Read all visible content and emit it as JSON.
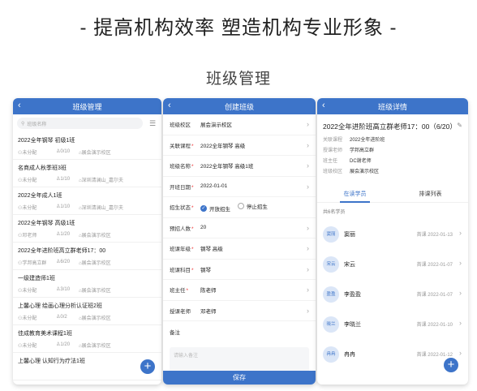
{
  "headline": "- 提高机构效率 塑造机构专业形象 -",
  "subtitle": "班级管理",
  "list_screen": {
    "title": "班级管理",
    "search_placeholder": "班级名称",
    "classes": [
      {
        "name": "2022全年钢琴 初级1班",
        "teacher": "未分配",
        "count": "0/10",
        "campus": "展会演示校区"
      },
      {
        "name": "名商成人秋季班3班",
        "teacher": "未分配",
        "count": "1/10",
        "campus": "深圳清澜山_嘉尔夫"
      },
      {
        "name": "2022全年成人1班",
        "teacher": "未分配",
        "count": "1/10",
        "campus": "深圳清澜山_嘉尔夫"
      },
      {
        "name": "2022全年钢琴 高级1班",
        "teacher": "邓老师",
        "count": "1/20",
        "campus": "展会演示校区"
      },
      {
        "name": "2022全年进阶班高立群老师17：00",
        "teacher": "学邦高立群",
        "count": "6/20",
        "campus": "展会演示校区"
      },
      {
        "name": "一级建造师1班",
        "teacher": "未分配",
        "count": "3/10",
        "campus": "展会演示校区"
      },
      {
        "name": "上馨心理 绘画心理分析认证班2班",
        "teacher": "未分配",
        "count": "0/2",
        "campus": "展会演示校区"
      },
      {
        "name": "佳成教育美术课程1班",
        "teacher": "未分配",
        "count": "1/20",
        "campus": "展会演示校区"
      },
      {
        "name": "上馨心理 认知行为疗法1班",
        "teacher": "",
        "count": "",
        "campus": ""
      }
    ]
  },
  "create_screen": {
    "title": "创建班级",
    "fields": [
      {
        "label": "班级校区",
        "required": false,
        "value": "展会演示校区"
      },
      {
        "label": "关联课程",
        "required": true,
        "value": "2022全年钢琴 高级"
      },
      {
        "label": "班级名称",
        "required": true,
        "value": "2022全年钢琴 高级1班"
      },
      {
        "label": "开班日期",
        "required": true,
        "value": "2022-01-01"
      }
    ],
    "status_label": "招生状态",
    "status_options": [
      "开放招生",
      "停止招生"
    ],
    "fields2": [
      {
        "label": "预招人数",
        "required": true,
        "value": "20"
      },
      {
        "label": "班课年级",
        "required": true,
        "value": "钢琴 高级"
      },
      {
        "label": "班课科目",
        "required": true,
        "value": "钢琴"
      },
      {
        "label": "班主任",
        "required": true,
        "value": "陈老师"
      },
      {
        "label": "授课老师",
        "required": false,
        "value": "邓老师"
      }
    ],
    "note_label": "备注",
    "note_placeholder": "请输入备注",
    "save_label": "保存"
  },
  "detail_screen": {
    "title": "班级详情",
    "class_title": "2022全年进阶班高立群老师17：00（6/20）",
    "info": [
      {
        "key": "关联课程",
        "value": "2022全年进阶班"
      },
      {
        "key": "授课老师",
        "value": "学邦高立群"
      },
      {
        "key": "班主任",
        "value": "DC谢老师"
      },
      {
        "key": "班级校区",
        "value": "展会演示校区"
      }
    ],
    "tabs": [
      "在读学员",
      "排课列表"
    ],
    "count_text": "共6名学员",
    "students": [
      {
        "avatar": "窦丽",
        "name": "窦丽",
        "date": "首课 2022-01-13"
      },
      {
        "avatar": "宋云",
        "name": "宋云",
        "date": "首课 2022-01-07"
      },
      {
        "avatar": "盈盈",
        "name": "李盈盈",
        "date": "首课 2022-01-07"
      },
      {
        "avatar": "晓兰",
        "name": "李晓兰",
        "date": "首课 2022-01-10"
      },
      {
        "avatar": "冉冉",
        "name": "冉冉",
        "date": "首课 2022-01-12"
      }
    ]
  },
  "colors": {
    "accent": "#3d74c9"
  }
}
